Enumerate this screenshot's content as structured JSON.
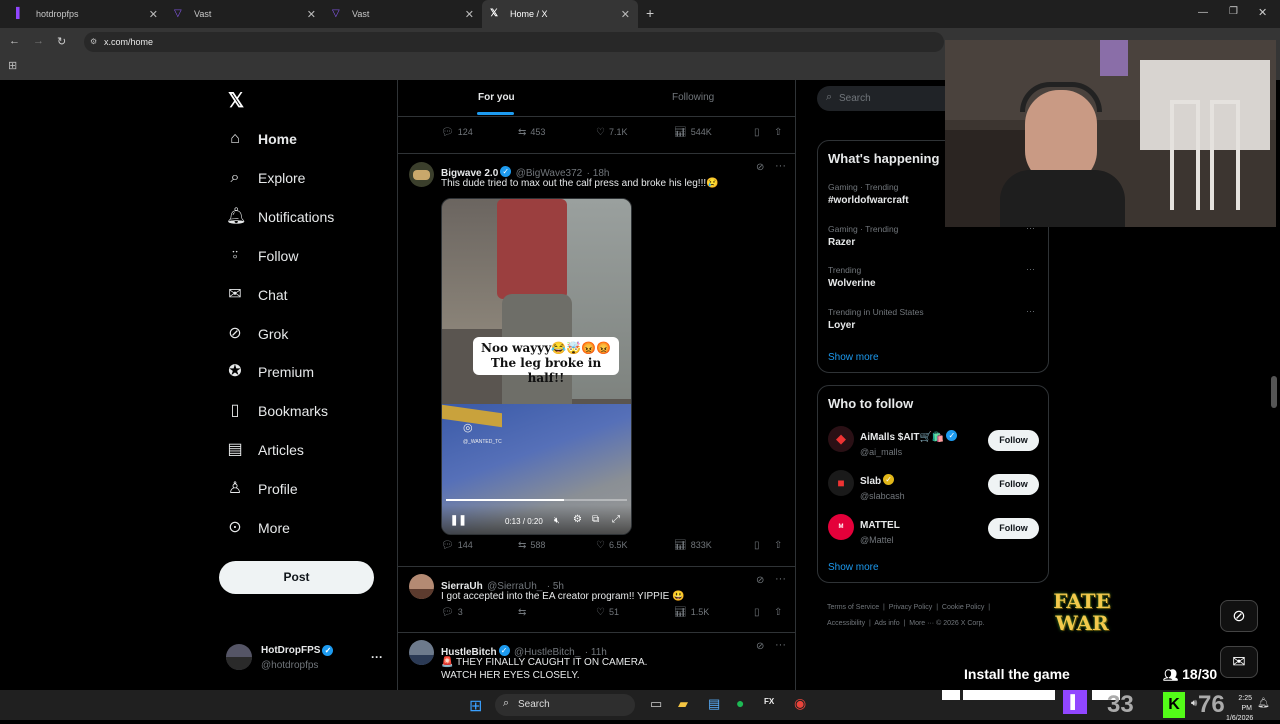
{
  "browser": {
    "tabs": [
      {
        "label": "hotdropfps",
        "favicon": "twitch-icon",
        "active": false
      },
      {
        "label": "Vast",
        "favicon": "vast-icon",
        "active": false
      },
      {
        "label": "Vast",
        "favicon": "vast-icon",
        "active": false
      },
      {
        "label": "Home / X",
        "favicon": "x-icon",
        "active": true
      }
    ],
    "url": "x.com/home"
  },
  "nav": {
    "items": [
      {
        "label": "Home",
        "icon": "home-icon"
      },
      {
        "label": "Explore",
        "icon": "search-icon"
      },
      {
        "label": "Notifications",
        "icon": "bell-icon"
      },
      {
        "label": "Follow",
        "icon": "person-plus-icon"
      },
      {
        "label": "Chat",
        "icon": "mail-icon"
      },
      {
        "label": "Grok",
        "icon": "grok-icon"
      },
      {
        "label": "Premium",
        "icon": "verified-icon"
      },
      {
        "label": "Bookmarks",
        "icon": "bookmark-icon"
      },
      {
        "label": "Articles",
        "icon": "article-icon"
      },
      {
        "label": "Profile",
        "icon": "person-icon"
      },
      {
        "label": "More",
        "icon": "more-circle-icon"
      }
    ],
    "post_label": "Post",
    "account": {
      "name": "HotDropFPS",
      "handle": "@hotdropfps"
    }
  },
  "timeline": {
    "tabs": [
      "For you",
      "Following"
    ],
    "prev_stats": {
      "replies": "124",
      "reposts": "453",
      "likes": "7.1K",
      "views": "544K"
    },
    "tweets": [
      {
        "name": "Bigwave 2.0",
        "handle": "@BigWave372",
        "time": "· 18h",
        "text": "This dude tried to max out the calf press and broke his leg!!!😢",
        "video": {
          "caption_line1": "Noo wayyy😂🤯😡😡",
          "caption_line2": "The leg broke in half!!",
          "watermark": "@_WANTED_TC",
          "time": "0:13 / 0:20",
          "progress": 0.65
        },
        "stats": {
          "replies": "144",
          "reposts": "588",
          "likes": "6.5K",
          "views": "833K"
        }
      },
      {
        "name": "SierraUh",
        "handle": "@SierraUh_",
        "time": "· 5h",
        "text": "I got accepted into the EA creator program!! YIPPIE 😃",
        "stats": {
          "replies": "3",
          "reposts": "",
          "likes": "51",
          "views": "1.5K"
        }
      },
      {
        "name": "HustleBitch",
        "handle": "@HustleBitch_",
        "time": "· 11h",
        "text_line1": "🚨 THEY FINALLY CAUGHT IT ON CAMERA.",
        "text_line2": "WATCH HER EYES CLOSELY."
      }
    ]
  },
  "sidebar": {
    "search_placeholder": "Search",
    "happening_title": "What's happening",
    "trends": [
      {
        "meta": "Gaming · Trending",
        "title": "#worldofwarcraft"
      },
      {
        "meta": "Gaming · Trending",
        "title": "Razer"
      },
      {
        "meta": "Trending",
        "title": "Wolverine"
      },
      {
        "meta": "Trending in United States",
        "title": "Loyer"
      }
    ],
    "show_more": "Show more",
    "wtf_title": "Who to follow",
    "who_to_follow": [
      {
        "name": "AiMalls $AIT🛒🛍️",
        "handle": "@ai_malls",
        "button": "Follow"
      },
      {
        "name": "Slab",
        "handle": "@slabcash",
        "button": "Follow"
      },
      {
        "name": "MATTEL",
        "handle": "@Mattel",
        "button": "Follow"
      }
    ],
    "footer_links": [
      "Terms of Service",
      "Privacy Policy",
      "Cookie Policy",
      "Accessibility",
      "Ads info",
      "More ···",
      "© 2026 X Corp."
    ]
  },
  "overlay": {
    "game_logo_line1": "FATE",
    "game_logo_line2": "WAR",
    "install_text": "Install the game",
    "viewer_count": "18/30",
    "score1": "33",
    "score2": "76",
    "clock_time": "2:25 PM",
    "clock_date": "1/6/2026"
  },
  "taskbar": {
    "search_label": "Search"
  },
  "colors": {
    "accent": "#1d9bf0",
    "background": "#000000",
    "border": "#2f3336"
  }
}
